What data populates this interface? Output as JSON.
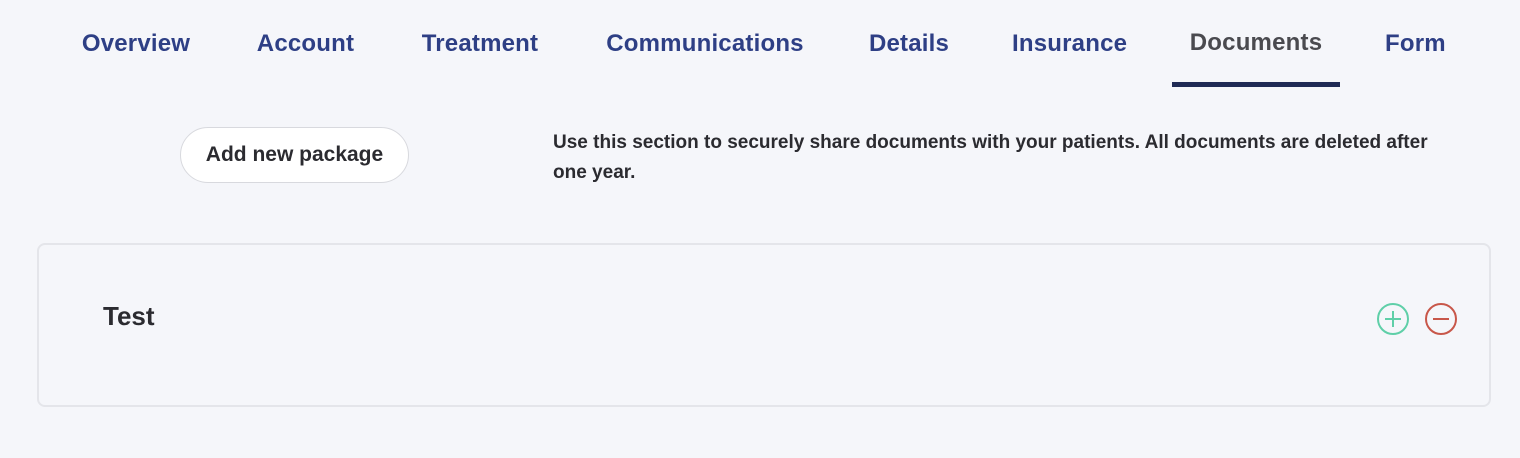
{
  "tabs": [
    {
      "label": "Overview"
    },
    {
      "label": "Account"
    },
    {
      "label": "Treatment"
    },
    {
      "label": "Communications"
    },
    {
      "label": "Details"
    },
    {
      "label": "Insurance"
    },
    {
      "label": "Documents",
      "active": true
    },
    {
      "label": "Form"
    }
  ],
  "documents": {
    "add_package_label": "Add new package",
    "info_text": "Use this section to securely share documents with your patients. All documents are deleted after one year."
  },
  "packages": [
    {
      "title": "Test",
      "add_icon": "plus-circle-icon",
      "remove_icon": "minus-circle-icon"
    }
  ],
  "colors": {
    "tab_text": "#2e3f85",
    "tab_active_text": "#4a4a4f",
    "tab_underline": "#1f2a55",
    "add_icon": "#5fcfa8",
    "remove_icon": "#c8574a",
    "background": "#f5f6fa"
  }
}
